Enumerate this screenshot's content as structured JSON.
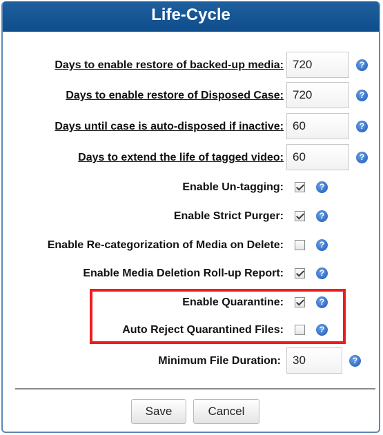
{
  "title": "Life-Cycle",
  "fields": [
    {
      "label": "Days to enable restore of backed-up media:",
      "value": "720"
    },
    {
      "label": "Days to enable restore of Disposed Case:",
      "value": "720"
    },
    {
      "label": "Days until case is auto-disposed if inactive:",
      "value": "60"
    },
    {
      "label": "Days to extend the life of tagged video:",
      "value": "60"
    }
  ],
  "options": [
    {
      "label": "Enable Un-tagging:",
      "checked": true
    },
    {
      "label": "Enable Strict Purger:",
      "checked": true
    },
    {
      "label": "Enable Re-categorization of Media on Delete:",
      "checked": false
    },
    {
      "label": "Enable Media Deletion Roll-up Report:",
      "checked": true
    },
    {
      "label": "Enable Quarantine:",
      "checked": true
    },
    {
      "label": "Auto Reject Quarantined Files:",
      "checked": false
    }
  ],
  "min_duration": {
    "label": "Minimum File Duration:",
    "value": "30"
  },
  "help_glyph": "?",
  "buttons": {
    "save": "Save",
    "cancel": "Cancel"
  },
  "colors": {
    "title_bar": "#0f4d8c",
    "highlight": "#ee1c1c",
    "help_icon": "#1c57b5"
  }
}
